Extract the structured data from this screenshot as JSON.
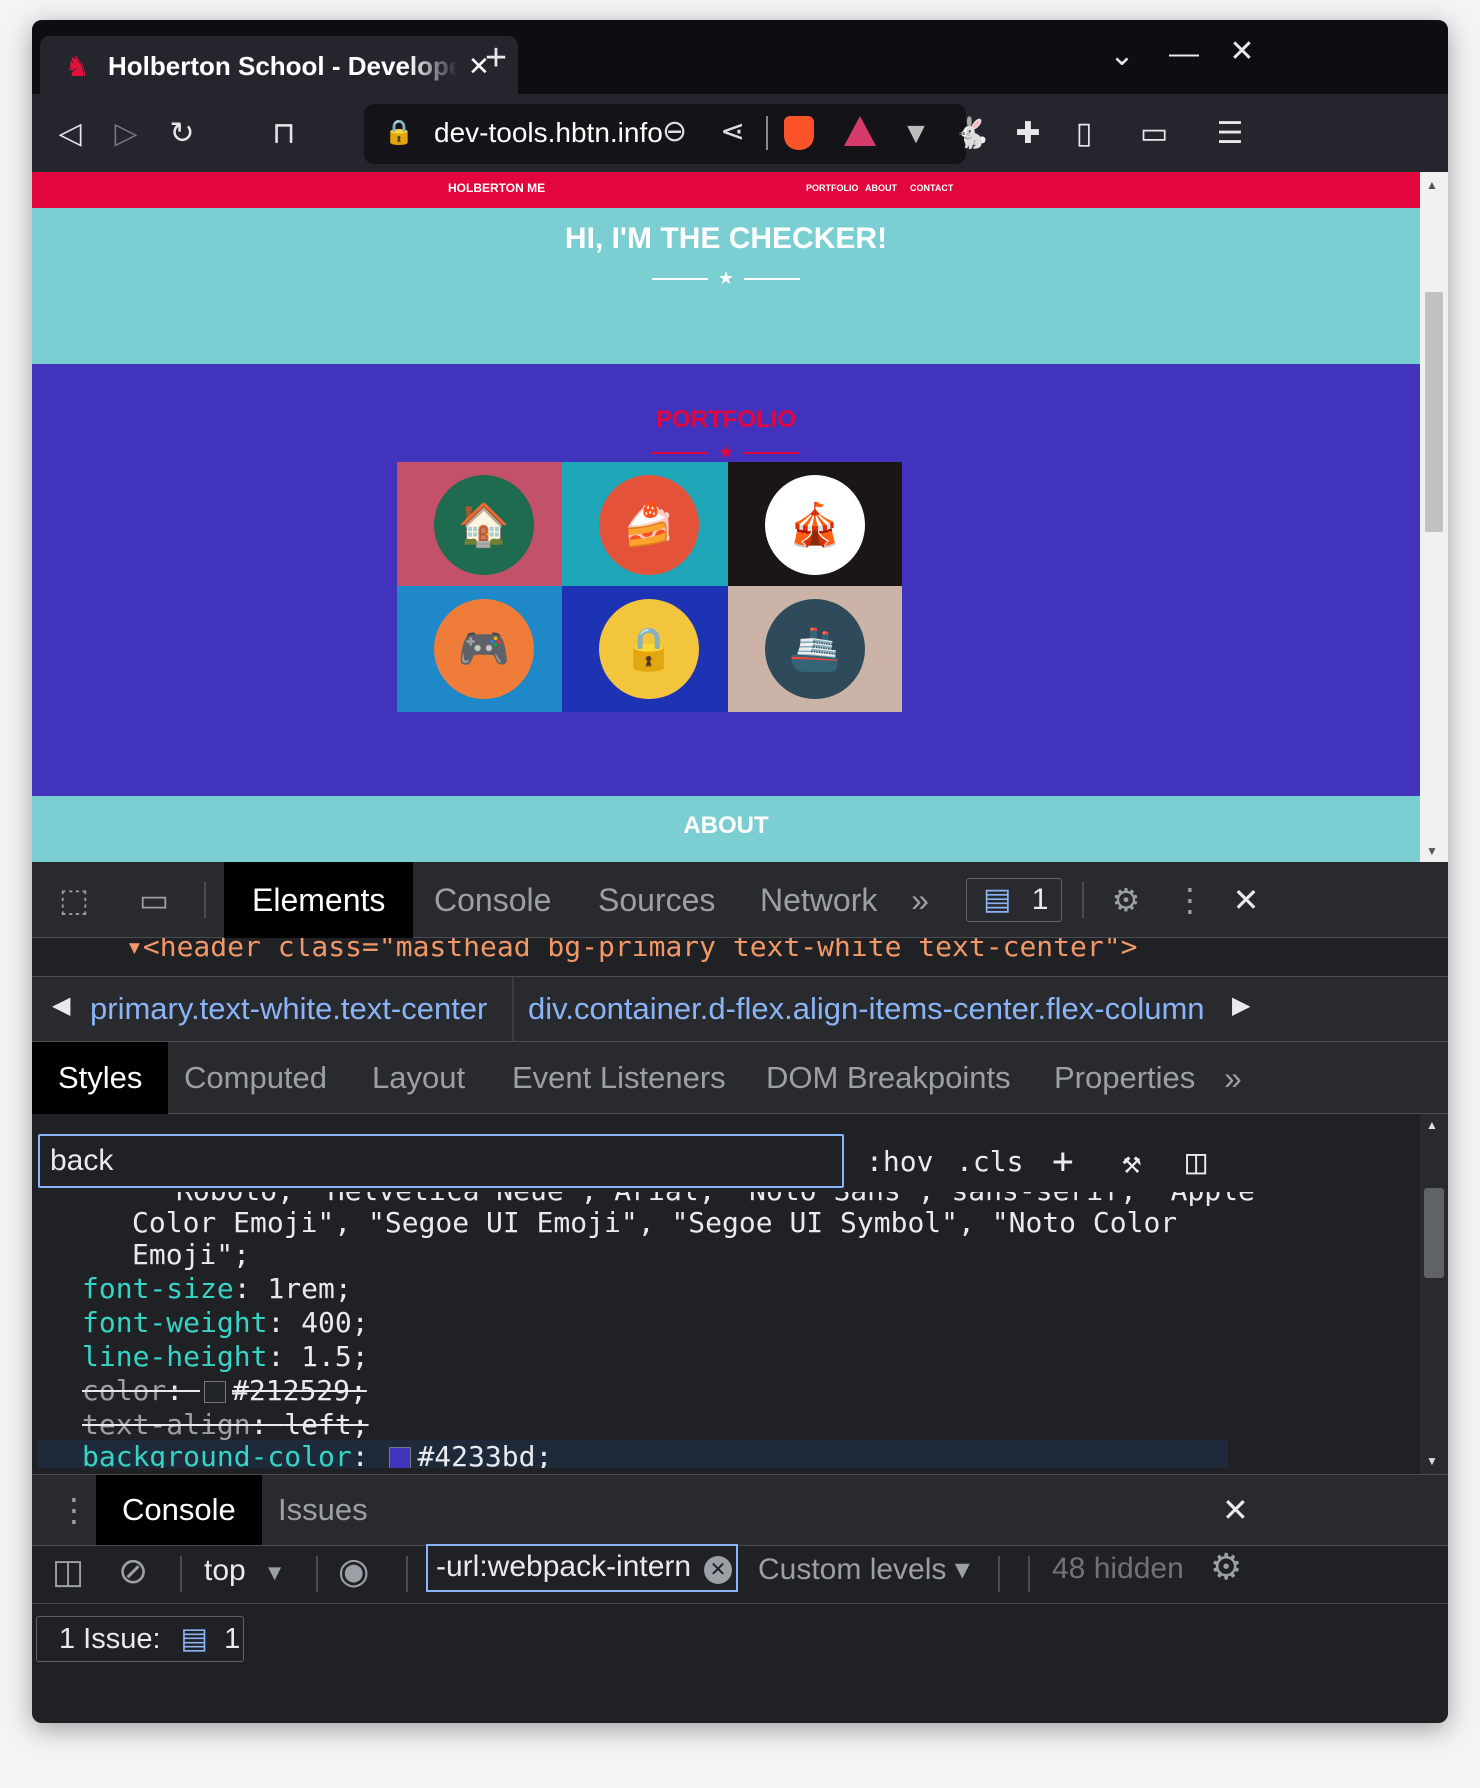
{
  "browser": {
    "tab_title": "Holberton School - Developer t",
    "tab_close": "✕",
    "new_tab": "+",
    "url": "dev-tools.hbtn.info",
    "window_controls": {
      "list": "⌄",
      "minimize": "—",
      "close": "✕"
    }
  },
  "page": {
    "nav_brand": "HOLBERTON ME",
    "nav_links": [
      "PORTFOLIO",
      "ABOUT",
      "CONTACT"
    ],
    "hero_title": "HI, I'M THE CHECKER!",
    "portfolio_title": "PORTFOLIO",
    "about_title": "ABOUT",
    "portfolio_items": [
      {
        "icon": "cabin-icon",
        "glyph": "🏠",
        "bg": "#c25169",
        "circle": "#1f6b4f"
      },
      {
        "icon": "cake-icon",
        "glyph": "🍰",
        "bg": "#1fa6b8",
        "circle": "#e5523a"
      },
      {
        "icon": "circus-icon",
        "glyph": "🎪",
        "bg": "#1b1616",
        "circle": "#ffffff"
      },
      {
        "icon": "game-controller-icon",
        "glyph": "🎮",
        "bg": "#1e88c9",
        "circle": "#ef7d39"
      },
      {
        "icon": "safe-icon",
        "glyph": "🔒",
        "bg": "#1c34b4",
        "circle": "#f2c53d"
      },
      {
        "icon": "submarine-icon",
        "glyph": "🚢",
        "bg": "#cbb3a7",
        "circle": "#2f4b5b"
      }
    ],
    "colors": {
      "nav": "#e2063c",
      "hero": "#7bcfd3",
      "portfolio": "#4233bd"
    }
  },
  "devtools": {
    "tabs": [
      "Elements",
      "Console",
      "Sources",
      "Network"
    ],
    "more_tabs": "»",
    "issues_badge": "1",
    "dom_line": "▾<header class=\"masthead bg-primary text-white text-center\">",
    "breadcrumbs": [
      "primary.text-white.text-center",
      "div.container.d-flex.align-items-center.flex-column"
    ],
    "styles_tabs": [
      "Styles",
      "Computed",
      "Layout",
      "Event Listeners",
      "DOM Breakpoints",
      "Properties"
    ],
    "filter_value": "back",
    "hov": ":hov",
    "cls": ".cls",
    "css_lines": {
      "font_family_1": "Roboto, \"Helvetica Neue\", Arial, \"Noto Sans\", sans-serif, \"Apple",
      "font_family_2": "Color Emoji\", \"Segoe UI Emoji\", \"Segoe UI Symbol\", \"Noto Color",
      "font_family_3": "Emoji\";",
      "font_size_prop": "font-size",
      "font_size_val": "1rem;",
      "font_weight_prop": "font-weight",
      "font_weight_val": "400;",
      "line_height_prop": "line-height",
      "line_height_val": "1.5;",
      "color_prop": "color",
      "color_val": "#212529;",
      "text_align_prop": "text-align",
      "text_align_val": "left;",
      "bg_prop": "background-color",
      "bg_val": "#4233bd;"
    },
    "drawer_tabs": [
      "Console",
      "Issues"
    ],
    "context": "top",
    "console_filter": "-url:webpack-intern",
    "levels": "Custom levels ▾",
    "hidden": "48 hidden",
    "issue_label": "1 Issue:",
    "issue_count": "1"
  }
}
